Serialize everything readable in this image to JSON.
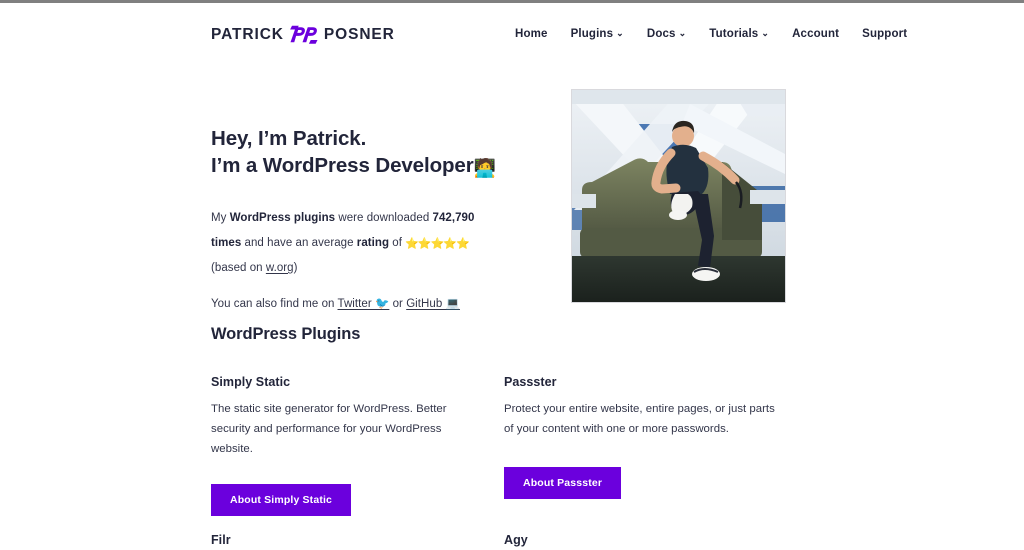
{
  "header": {
    "logo": {
      "word_left": "PATRICK",
      "word_right": "POSNER",
      "mark_name": "pp-monogram-logo",
      "mark_color": "#6b00dd"
    },
    "nav": [
      {
        "label": "Home",
        "has_caret": false,
        "caret": ""
      },
      {
        "label": "Plugins",
        "has_caret": true,
        "caret": "⌄"
      },
      {
        "label": "Docs",
        "has_caret": true,
        "caret": "⌄"
      },
      {
        "label": "Tutorials",
        "has_caret": true,
        "caret": "⌄"
      },
      {
        "label": "Account",
        "has_caret": false,
        "caret": ""
      },
      {
        "label": "Support",
        "has_caret": false,
        "caret": ""
      }
    ]
  },
  "hero": {
    "title_line1": "Hey, I’m Patrick.",
    "title_line2": "I’m a WordPress Developer",
    "title_emoji": "🧑‍💻",
    "para1": {
      "t1": "My ",
      "b1": "WordPress plugins",
      "t2": " were downloaded ",
      "b2": "742,790 times",
      "t3": " and have an average ",
      "b3": "rating",
      "t4": " of ",
      "stars": "⭐⭐⭐⭐⭐",
      "t5": " (based on ",
      "link": "w.org",
      "t6": ")"
    },
    "para2": {
      "t1": "You can also find me on ",
      "link1": "Twitter 🐦",
      "t2": " or ",
      "link2": "GitHub 💻"
    },
    "photo_alt": "Patrick sitting on an olive-green couch in a modern building with white beams"
  },
  "plugins_section": {
    "title": "WordPress Plugins",
    "row1": [
      {
        "name": "Simply Static",
        "description": "The static site generator for WordPress. Better security and performance for your WordPress website.",
        "button_label": "About Simply Static"
      },
      {
        "name": "Passster",
        "description": "Protect your entire website, entire pages, or just parts of your content with one or more passwords.",
        "button_label": "About Passster"
      }
    ],
    "row2": [
      {
        "name": "Filr"
      },
      {
        "name": "Agy"
      }
    ]
  },
  "colors": {
    "accent_purple": "#6b00dd",
    "text_dark": "#22253a",
    "text_body": "#33364a",
    "background": "#ffffff",
    "chrome_edge": "#808080"
  }
}
